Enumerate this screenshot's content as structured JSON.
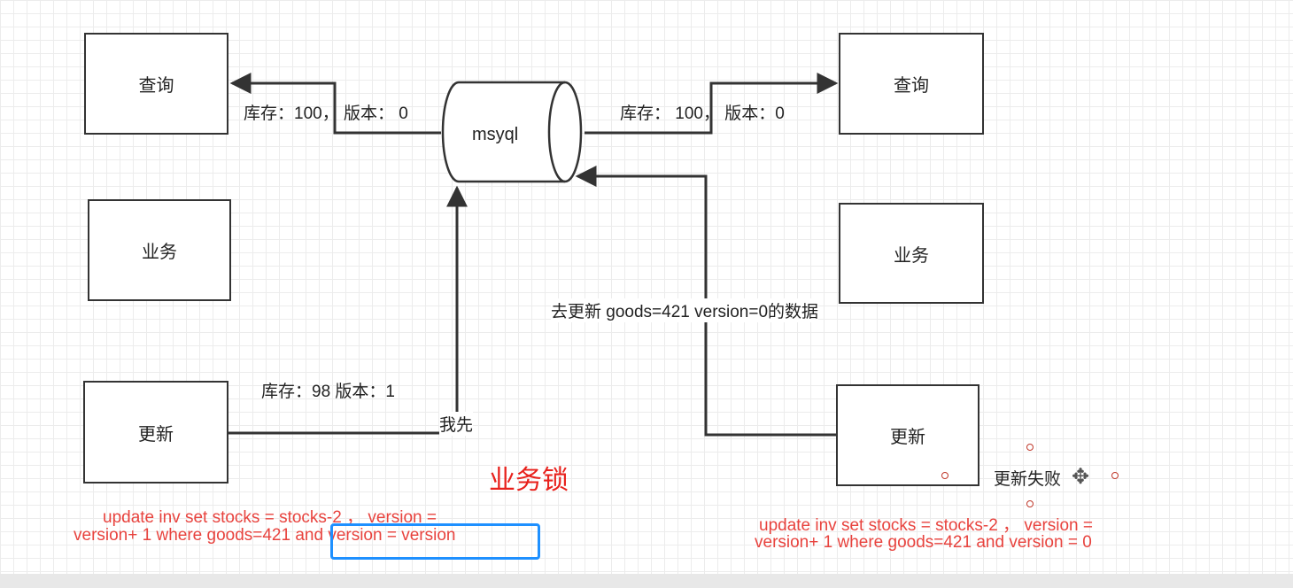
{
  "left": {
    "query_box": "查询",
    "business_box": "业务",
    "update_box": "更新",
    "query_edge_label": "库存：100， 版本： 0",
    "update_edge_label": "库存：98 版本：1",
    "update_edge_note": "我先",
    "sql_line1": "update inv set stocks = stocks-2 ，  version =",
    "sql_line2": "version+ 1 where goods=421 and version = version"
  },
  "right": {
    "query_box": "查询",
    "business_box": "业务",
    "update_box": "更新",
    "query_edge_label": "库存： 100， 版本：0",
    "update_edge_label": "去更新 goods=421 version=0的数据",
    "fail_label": "更新失败",
    "sql_line1": "update inv set stocks = stocks-2 ，  version =",
    "sql_line2": "version+ 1 where goods=421 and version = 0"
  },
  "db_label": "msyql",
  "center_title": "业务锁",
  "colors": {
    "stroke": "#333333",
    "red_text": "#e8433e",
    "title_red": "#e8211c",
    "highlight": "#1e90ff",
    "grid": "#ececec"
  },
  "icons": {
    "move": "move-cross-icon"
  }
}
